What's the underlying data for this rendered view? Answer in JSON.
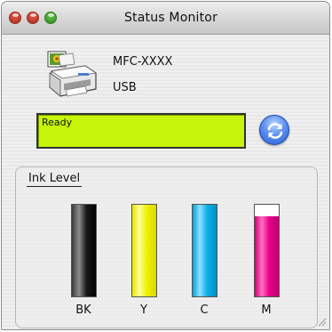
{
  "window": {
    "title": "Status Monitor"
  },
  "device": {
    "model": "MFC-XXXX",
    "connection": "USB",
    "icon": "printer-icon"
  },
  "status": {
    "text": "Ready",
    "color": "#c6f50a"
  },
  "refresh": {
    "icon": "refresh-icon"
  },
  "ink": {
    "title": "Ink Level",
    "cartridges": [
      {
        "label": "BK",
        "color": "#000000",
        "level": 1.0
      },
      {
        "label": "Y",
        "color": "#ffff00",
        "level": 1.0
      },
      {
        "label": "C",
        "color": "#00b4e6",
        "level": 1.0
      },
      {
        "label": "M",
        "color": "#e5008a",
        "level": 0.87
      }
    ]
  }
}
